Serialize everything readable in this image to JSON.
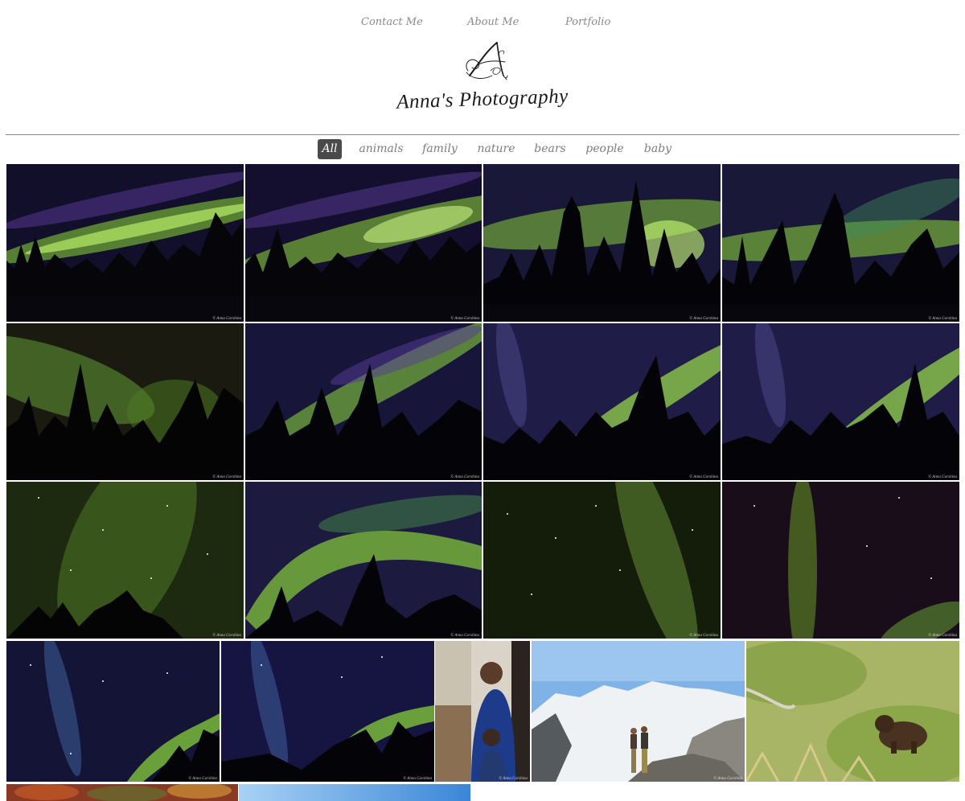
{
  "nav": {
    "contact": "Contact Me",
    "about": "About Me",
    "portfolio": "Portfolio"
  },
  "brand": {
    "monogram": "A",
    "name": "Anna's Photography"
  },
  "filters": [
    "All",
    "animals",
    "family",
    "nature",
    "bears",
    "people",
    "baby"
  ],
  "active_filter": "All",
  "watermark": "© Anna Gorshina",
  "colors": {
    "nav_text": "#8a8a8a",
    "active_filter_bg": "#4a4a4a",
    "divider": "#8a8a8a"
  },
  "photos": [
    {
      "subject": "aurora-forest"
    },
    {
      "subject": "aurora-forest"
    },
    {
      "subject": "aurora-spruce"
    },
    {
      "subject": "aurora-spruce"
    },
    {
      "subject": "aurora-forest"
    },
    {
      "subject": "aurora-forest"
    },
    {
      "subject": "aurora-spruce"
    },
    {
      "subject": "aurora-spruce"
    },
    {
      "subject": "aurora-stars"
    },
    {
      "subject": "aurora-forest"
    },
    {
      "subject": "aurora-stars"
    },
    {
      "subject": "aurora-stars"
    },
    {
      "subject": "aurora-curtain"
    },
    {
      "subject": "aurora-curtain"
    },
    {
      "subject": "family-portrait"
    },
    {
      "subject": "glacier-couple"
    },
    {
      "subject": "bear-in-grass"
    },
    {
      "subject": "autumn-foliage"
    },
    {
      "subject": "blue-sky"
    }
  ]
}
